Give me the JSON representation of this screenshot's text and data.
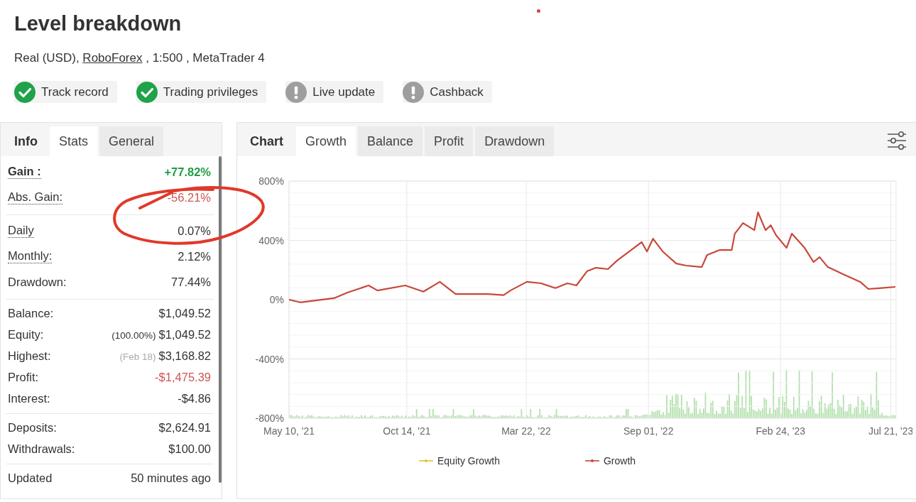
{
  "title": "Level breakdown",
  "account": {
    "type": "Real (USD),",
    "broker": "RoboForex",
    "details": ", 1:500 , MetaTrader 4"
  },
  "badges": [
    {
      "label": "Track record",
      "verified": true
    },
    {
      "label": "Trading privileges",
      "verified": true
    },
    {
      "label": "Live update",
      "verified": false
    },
    {
      "label": "Cashback",
      "verified": false
    }
  ],
  "stats_panel": {
    "heading": "Info",
    "tabs": [
      {
        "label": "Stats",
        "selected": true
      },
      {
        "label": "General",
        "selected": false
      }
    ],
    "groups": [
      {
        "rows": [
          {
            "label": "Gain :",
            "value": "+77.82%",
            "color": "#1f9d45",
            "underlined": true,
            "bold": true
          },
          {
            "label": "Abs. Gain:",
            "value": "-56.21%",
            "color": "#cd5652",
            "underlined": true,
            "bold": false
          }
        ]
      },
      {
        "rows": [
          {
            "label": "Daily",
            "value": "0.07%",
            "color": "#333333",
            "underlined": true,
            "bold": false
          },
          {
            "label": "Monthly:",
            "value": "2.12%",
            "color": "#333333",
            "underlined": true,
            "bold": false
          },
          {
            "label": "Drawdown:",
            "value": "77.44%",
            "color": "#333333",
            "underlined": false,
            "bold": false
          }
        ]
      },
      {
        "rows": [
          {
            "label": "Balance:",
            "value": "$1,049.52",
            "color": "#333333",
            "underlined": false,
            "bold": false
          },
          {
            "label": "Equity:",
            "note": {
              "text": "(100.00%)",
              "muted": false
            },
            "value": "$1,049.52",
            "color": "#333333",
            "underlined": false,
            "bold": false
          },
          {
            "label": "Highest:",
            "note": {
              "text": "(Feb 18)",
              "muted": true
            },
            "value": "$3,168.82",
            "color": "#333333",
            "underlined": false,
            "bold": false
          },
          {
            "label": "Profit:",
            "value": "-$1,475.39",
            "color": "#cd5652",
            "underlined": false,
            "bold": false
          },
          {
            "label": "Interest:",
            "value": "-$4.86",
            "color": "#333333",
            "underlined": false,
            "bold": false
          }
        ]
      },
      {
        "rows": [
          {
            "label": "Deposits:",
            "value": "$2,624.91",
            "color": "#333333",
            "underlined": false,
            "bold": false
          },
          {
            "label": "Withdrawals:",
            "value": "$100.00",
            "color": "#333333",
            "underlined": false,
            "bold": false
          }
        ]
      },
      {
        "rows": [
          {
            "label": "Updated",
            "value": "50 minutes ago",
            "color": "#333333",
            "underlined": false,
            "bold": false
          }
        ]
      }
    ]
  },
  "chart_panel": {
    "heading": "Chart",
    "tabs": [
      {
        "label": "Growth",
        "selected": true
      },
      {
        "label": "Balance",
        "selected": false
      },
      {
        "label": "Profit",
        "selected": false
      },
      {
        "label": "Drawdown",
        "selected": false
      }
    ],
    "chart_data": [
      {
        "type": "line",
        "legend": "bottom",
        "grid": true,
        "x": [
          "2021-05-10",
          "2021-05-25",
          "2021-07-09",
          "2021-07-27",
          "2021-08-24",
          "2021-09-05",
          "2021-10-12",
          "2021-11-05",
          "2021-11-27",
          "2021-12-18",
          "2022-01-30",
          "2022-02-20",
          "2022-03-01",
          "2022-03-23",
          "2022-04-11",
          "2022-04-30",
          "2022-05-16",
          "2022-05-28",
          "2022-06-11",
          "2022-06-23",
          "2022-07-09",
          "2022-07-21",
          "2022-08-09",
          "2022-08-23",
          "2022-08-30",
          "2022-09-07",
          "2022-09-20",
          "2022-10-08",
          "2022-10-21",
          "2022-11-11",
          "2022-11-18",
          "2022-12-05",
          "2022-12-21",
          "2022-12-25",
          "2023-01-05",
          "2023-01-20",
          "2023-01-25",
          "2023-02-04",
          "2023-02-11",
          "2023-02-18",
          "2023-03-04",
          "2023-03-11",
          "2023-03-28",
          "2023-04-09",
          "2023-04-17",
          "2023-04-28",
          "2023-05-18",
          "2023-06-10",
          "2023-06-21",
          "2023-07-06",
          "2023-07-27"
        ],
        "series": [
          {
            "name": "Equity Growth",
            "color": "#e3c23a",
            "values": [
              null,
              null,
              null,
              null,
              null,
              null,
              null,
              null,
              null,
              null,
              null,
              null,
              null,
              null,
              null,
              null,
              null,
              null,
              null,
              null,
              null,
              null,
              null,
              null,
              null,
              null,
              null,
              null,
              null,
              null,
              null,
              null,
              null,
              null,
              null,
              null,
              null,
              null,
              null,
              null,
              null,
              null,
              null,
              null,
              null,
              null,
              null,
              null,
              null,
              null,
              null
            ]
          },
          {
            "name": "Growth",
            "color": "#c9473a",
            "values": [
              0,
              -18,
              10,
              48,
              96,
              62,
              96,
              54,
              120,
              38,
              38,
              30,
              62,
              120,
              110,
              78,
              110,
              96,
              191,
              215,
              206,
              263,
              335,
              388,
              325,
              411,
              325,
              244,
              230,
              220,
              301,
              335,
              335,
              445,
              517,
              469,
              589,
              469,
              502,
              435,
              349,
              445,
              349,
              254,
              287,
              220,
              172,
              120,
              72,
              77,
              86
            ]
          }
        ],
        "xlim": [
          "2021-05-10",
          "2023-07-28"
        ],
        "xticks": [
          {
            "value": "2021-05-10",
            "label": "May 10, '21"
          },
          {
            "value": "2021-10-14",
            "label": "Oct 14, '21"
          },
          {
            "value": "2022-03-22",
            "label": "Mar 22, '22"
          },
          {
            "value": "2022-09-01",
            "label": "Sep 01, '22"
          },
          {
            "value": "2023-02-24",
            "label": "Feb 24, '23"
          },
          {
            "value": "2023-07-21",
            "label": "Jul 21, '23"
          }
        ],
        "ylim": [
          -800,
          800
        ],
        "yticks": [
          {
            "value": -800,
            "label": "-800%"
          },
          {
            "value": -400,
            "label": "-400%"
          },
          {
            "value": 0,
            "label": "0%"
          },
          {
            "value": 400,
            "label": "400%"
          },
          {
            "value": 800,
            "label": "800%"
          }
        ]
      }
    ]
  }
}
